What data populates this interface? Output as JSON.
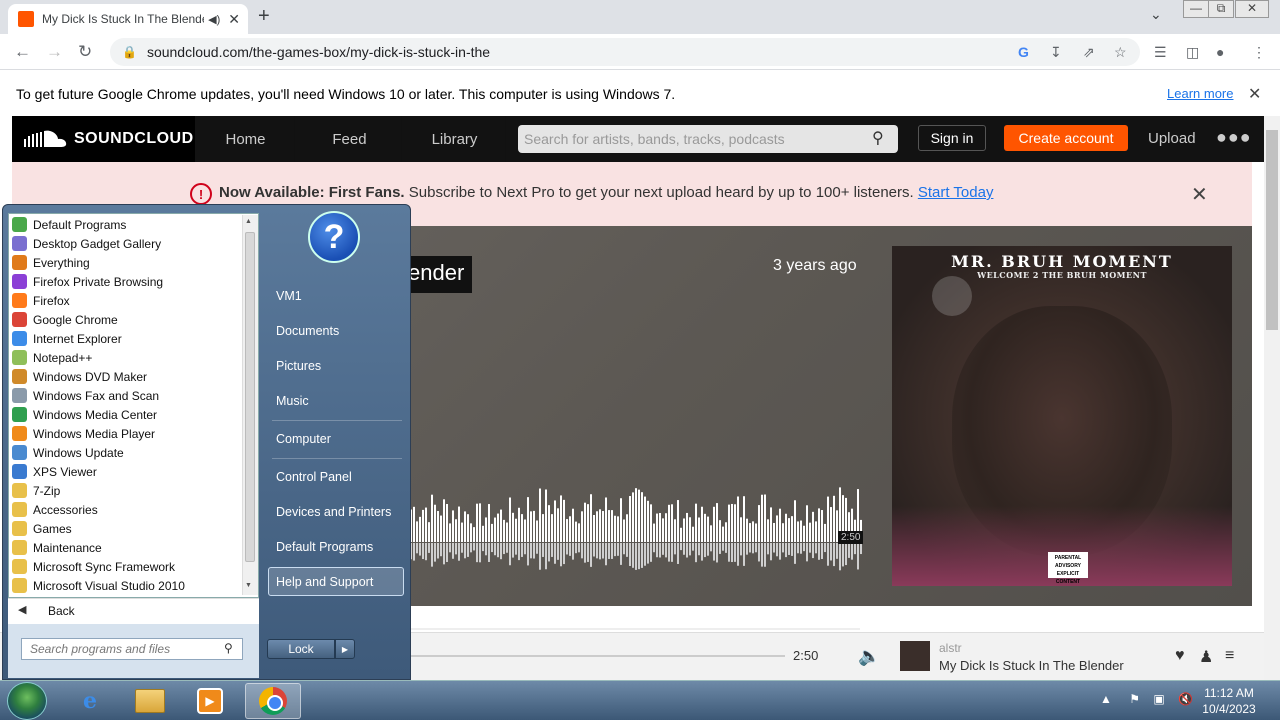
{
  "browser": {
    "tab_title": "My Dick Is Stuck In The Blender",
    "url": "soundcloud.com/the-games-box/my-dick-is-stuck-in-the",
    "infobar_text": "To get future Google Chrome updates, you'll need Windows 10 or later. This computer is using Windows 7.",
    "infobar_link": "Learn more"
  },
  "soundcloud": {
    "logo": "SOUNDCLOUD",
    "nav": [
      "Home",
      "Feed",
      "Library"
    ],
    "search_placeholder": "Search for artists, bands, tracks, podcasts",
    "sign_in": "Sign in",
    "create_account": "Create account",
    "upload": "Upload",
    "banner": {
      "bold": "Now Available: First Fans.",
      "text": "Subscribe to Next Pro to get your next upload heard by up to 100+ listeners.",
      "link": "Start Today"
    },
    "hero": {
      "title_visible": "ender",
      "posted": "3 years ago",
      "duration": "2:50",
      "art_title": "MR. BRUH MOMENT",
      "art_subtitle": "WELCOME 2 THE BRUH MOMENT",
      "advisory": "PARENTAL ADVISORY EXPLICIT CONTENT"
    },
    "player": {
      "time": "2:50",
      "artist": "alstr",
      "title": "My Dick Is Stuck In The Blender"
    }
  },
  "start_menu": {
    "programs": [
      {
        "label": "Default Programs",
        "color": "#4aa84a"
      },
      {
        "label": "Desktop Gadget Gallery",
        "color": "#7a6fd0"
      },
      {
        "label": "Everything",
        "color": "#e07a1a"
      },
      {
        "label": "Firefox Private Browsing",
        "color": "#8b3fd6"
      },
      {
        "label": "Firefox",
        "color": "#ff7a1a"
      },
      {
        "label": "Google Chrome",
        "color": "#db4437"
      },
      {
        "label": "Internet Explorer",
        "color": "#3c8ce8"
      },
      {
        "label": "Notepad++",
        "color": "#8fbf5a"
      },
      {
        "label": "Windows DVD Maker",
        "color": "#d08a2a"
      },
      {
        "label": "Windows Fax and Scan",
        "color": "#8a9aaa"
      },
      {
        "label": "Windows Media Center",
        "color": "#2f9f4f"
      },
      {
        "label": "Windows Media Player",
        "color": "#f08a1a"
      },
      {
        "label": "Windows Update",
        "color": "#4a8ad0"
      },
      {
        "label": "XPS Viewer",
        "color": "#3a7ad0"
      },
      {
        "label": "7-Zip",
        "color": "#e8c04a"
      },
      {
        "label": "Accessories",
        "color": "#e8c04a"
      },
      {
        "label": "Games",
        "color": "#e8c04a"
      },
      {
        "label": "Maintenance",
        "color": "#e8c04a"
      },
      {
        "label": "Microsoft Sync Framework",
        "color": "#e8c04a"
      },
      {
        "label": "Microsoft Visual Studio 2010",
        "color": "#e8c04a"
      }
    ],
    "back": "Back",
    "search_placeholder": "Search programs and files",
    "right_items": [
      "VM1",
      "Documents",
      "Pictures",
      "Music",
      "Computer",
      "Control Panel",
      "Devices and Printers",
      "Default Programs",
      "Help and Support"
    ],
    "lock": "Lock"
  },
  "taskbar": {
    "time": "11:12 AM",
    "date": "10/4/2023"
  },
  "colors": {
    "accent": "#ff5500",
    "sc_header": "#121212",
    "banner_bg": "#f9e2e2"
  }
}
